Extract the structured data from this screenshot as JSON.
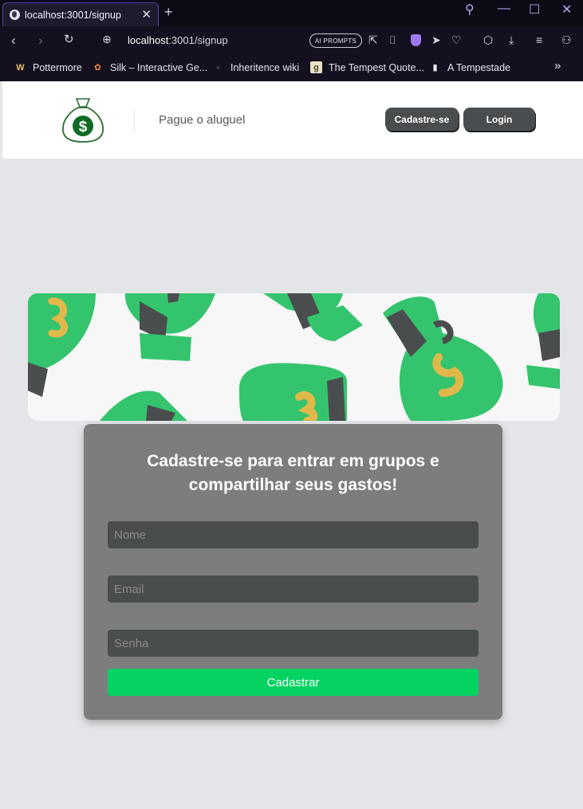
{
  "browser": {
    "tab_title": "localhost:3001/signup",
    "new_tab_label": "+",
    "url_host": "localhost",
    "url_rest": ":3001/signup",
    "ai_prompts_label": "AI PROMPTS",
    "bookmarks": [
      {
        "label": "Pottermore",
        "icon": "W"
      },
      {
        "label": "Silk – Interactive Ge...",
        "icon": "✿"
      },
      {
        "label": "Inheritence wiki",
        "icon": "●"
      },
      {
        "label": "The Tempest Quote...",
        "icon": "g"
      },
      {
        "label": "A Tempestade",
        "icon": "▮"
      }
    ],
    "more_bookmarks": "»"
  },
  "header": {
    "brand_text": "Pague o aluguel",
    "signup_label": "Cadastre-se",
    "login_label": "Login",
    "logo_icon": "money-bag-icon"
  },
  "signup_card": {
    "title": "Cadastre-se para entrar em grupos e compartilhar seus gastos!",
    "name_placeholder": "Nome",
    "email_placeholder": "Email",
    "password_placeholder": "Senha",
    "submit_label": "Cadastrar"
  },
  "colors": {
    "accent_green": "#04d361",
    "bag_green": "#34c46e",
    "card_bg": "#7d7d7d",
    "button_dark": "#4a4d4f"
  }
}
